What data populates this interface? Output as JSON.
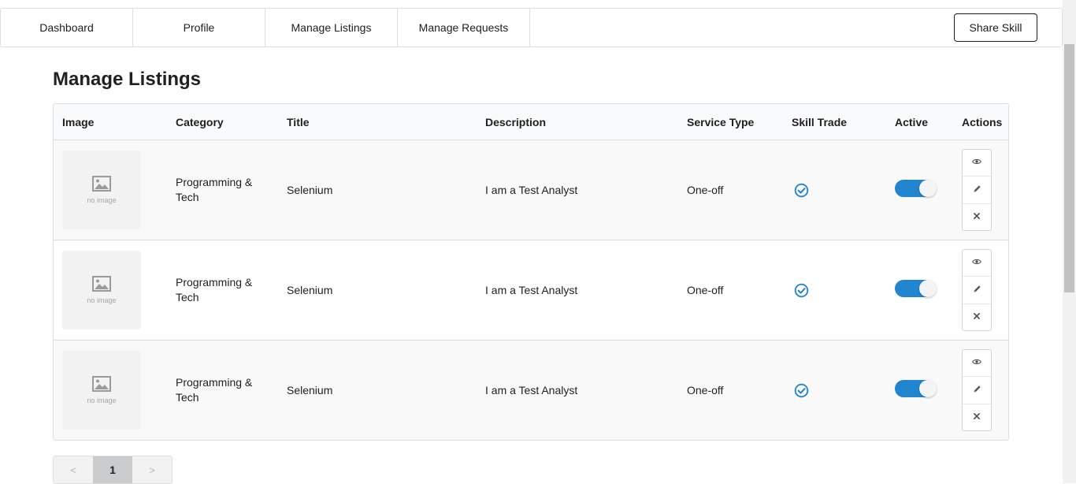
{
  "nav": {
    "items": [
      {
        "label": "Dashboard"
      },
      {
        "label": "Profile"
      },
      {
        "label": "Manage Listings"
      },
      {
        "label": "Manage Requests"
      }
    ],
    "share_label": "Share Skill"
  },
  "page_title": "Manage Listings",
  "table": {
    "headers": [
      "Image",
      "Category",
      "Title",
      "Description",
      "Service Type",
      "Skill Trade",
      "Active",
      "Actions"
    ],
    "rows": [
      {
        "image_text": "no image",
        "category": "Programming & Tech",
        "title": "Selenium",
        "description": "I am a Test Analyst",
        "service_type": "One-off",
        "skill_trade": true,
        "active": true
      },
      {
        "image_text": "no image",
        "category": "Programming & Tech",
        "title": "Selenium",
        "description": "I am a Test Analyst",
        "service_type": "One-off",
        "skill_trade": true,
        "active": true
      },
      {
        "image_text": "no image",
        "category": "Programming & Tech",
        "title": "Selenium",
        "description": "I am a Test Analyst",
        "service_type": "One-off",
        "skill_trade": true,
        "active": true
      }
    ]
  },
  "pagination": {
    "prev": "<",
    "pages": [
      "1"
    ],
    "next": ">"
  },
  "colors": {
    "accent": "#2185d0",
    "active_page": "#cacbcd"
  },
  "icons": {
    "view": "eye-icon",
    "edit": "pencil-icon",
    "delete": "close-icon",
    "skill_trade": "check-circle-icon",
    "placeholder": "image-icon"
  }
}
